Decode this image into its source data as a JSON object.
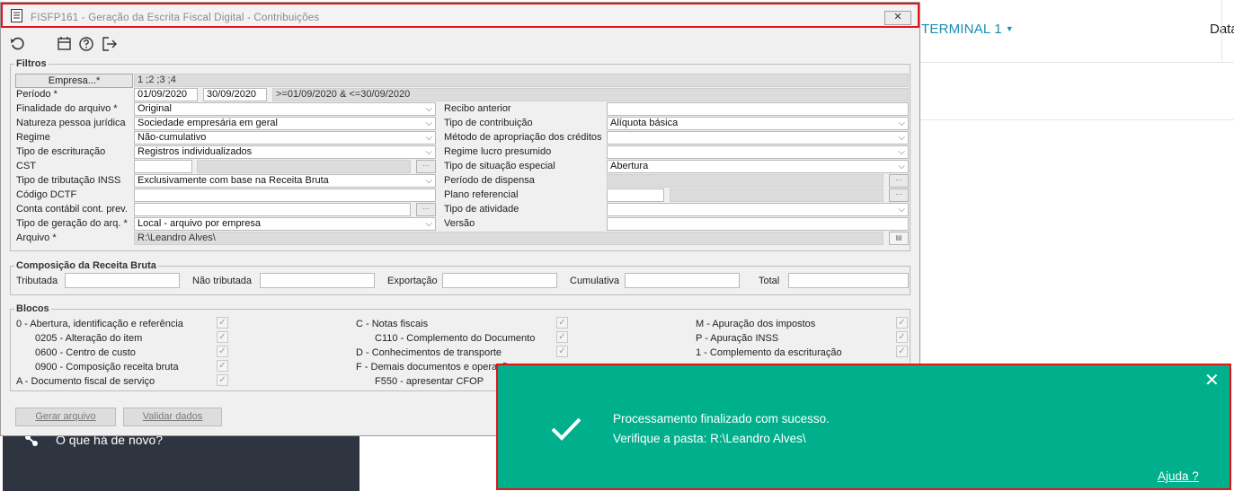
{
  "background": {
    "terminal_label": "TERMINAL 1",
    "date_label": "Data",
    "news_label": "O que há de novo?"
  },
  "window": {
    "title": "FISFP161 - Geração da Escrita Fiscal Digital - Contribuições",
    "close_glyph": "✕"
  },
  "filtros": {
    "group_title": "Filtros",
    "empresa_button": "Empresa...*",
    "empresa_value": "1 ;2 ;3 ;4",
    "periodo_label": "Período *",
    "periodo_inicio": "01/09/2020",
    "periodo_fim": "30/09/2020",
    "periodo_expr": ">=01/09/2020 & <=30/09/2020",
    "finalidade_label": "Finalidade do arquivo *",
    "finalidade_value": "Original",
    "natureza_label": "Natureza pessoa jurídica",
    "natureza_value": "Sociedade empresária em geral",
    "regime_label": "Regime",
    "regime_value": "Não-cumulativo",
    "tipo_escrituracao_label": "Tipo de escrituração",
    "tipo_escrituracao_value": "Registros individualizados",
    "cst_label": "CST",
    "tipo_tributacao_label": "Tipo de tributação INSS",
    "tipo_tributacao_value": "Exclusivamente com base na Receita Bruta",
    "codigo_dctf_label": "Código DCTF",
    "conta_contabil_label": "Conta contábil cont. prev.",
    "tipo_geracao_label": "Tipo de geração do arq. *",
    "tipo_geracao_value": "Local - arquivo por empresa",
    "arquivo_label": "Arquivo *",
    "arquivo_value": "R:\\Leandro Alves\\",
    "recibo_label": "Recibo anterior",
    "tipo_contribuicao_label": "Tipo de contribuição",
    "tipo_contribuicao_value": "Alíquota básica",
    "metodo_label": "Método de apropriação dos créditos",
    "regime_lucro_label": "Regime lucro presumido",
    "situacao_label": "Tipo de situação especial",
    "situacao_value": "Abertura",
    "periodo_dispensa_label": "Período de dispensa",
    "plano_referencial_label": "Plano referencial",
    "tipo_atividade_label": "Tipo de atividade",
    "versao_label": "Versão"
  },
  "composicao": {
    "group_title": "Composição da Receita Bruta",
    "tributada_label": "Tributada",
    "nao_tributada_label": "Não tributada",
    "exportacao_label": "Exportação",
    "cumulativa_label": "Cumulativa",
    "total_label": "Total"
  },
  "blocos": {
    "group_title": "Blocos",
    "col1": [
      "0 - Abertura, identificação e referência",
      "0205 - Alteração do item",
      "0600 - Centro de custo",
      "0900 - Composição receita bruta",
      "A - Documento fiscal de serviço"
    ],
    "col2": [
      "C - Notas fiscais",
      "C110 - Complemento do Documento",
      "D - Conhecimentos de transporte",
      "F - Demais documentos e operações",
      "F550 - apresentar CFOP"
    ],
    "col3": [
      "M - Apuração dos impostos",
      "P - Apuração INSS",
      "1 - Complemento da escrituração"
    ]
  },
  "buttons": {
    "gerar": "Gerar arquivo",
    "validar": "Validar dados"
  },
  "toast": {
    "line1": "Processamento finalizado com sucesso.",
    "line2": "Verifique a pasta: R:\\Leandro Alves\\",
    "help": "Ajuda ?",
    "close_glyph": "✕"
  },
  "colors": {
    "toast_bg": "#00b08c",
    "highlight": "#e4141b",
    "terminal_link": "#1b8bb5"
  }
}
